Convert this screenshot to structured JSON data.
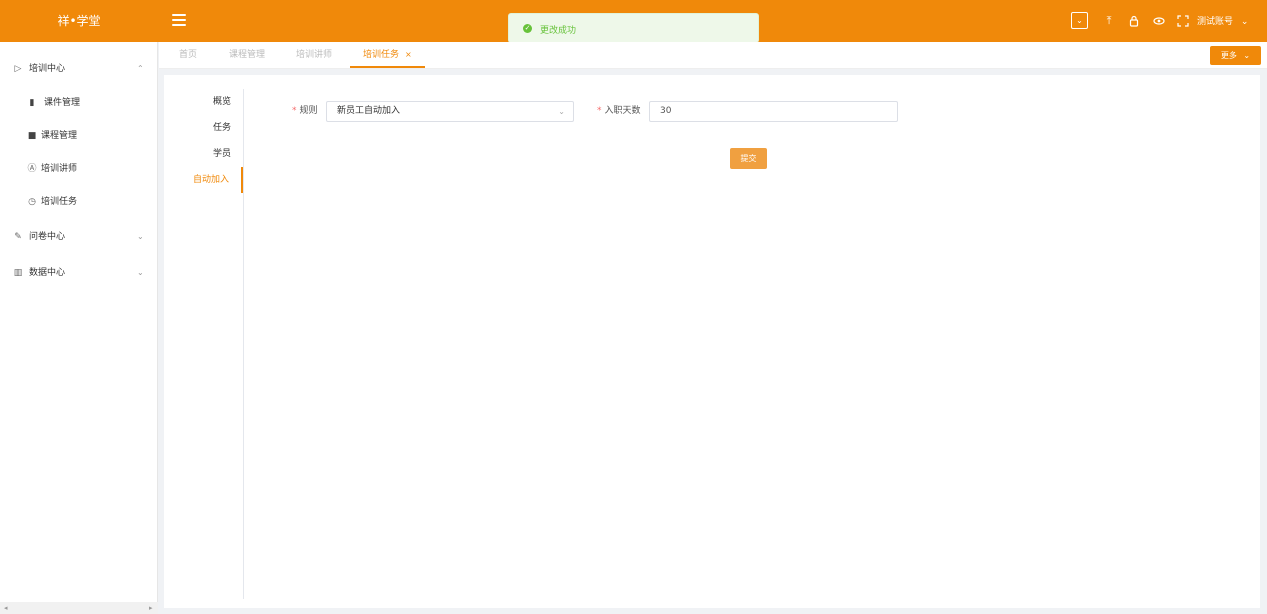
{
  "app": {
    "logo": "祥•学堂"
  },
  "toast": {
    "message": "更改成功",
    "icon": "check-circle-icon"
  },
  "header": {
    "icons": [
      "dropdown-box-icon",
      "upload-icon",
      "lock-icon",
      "eye-icon",
      "fullscreen-icon"
    ],
    "user_name": "测试账号"
  },
  "sidebar": {
    "groups": [
      {
        "label": "培训中心",
        "icon": "play-square-icon",
        "expanded": true
      },
      {
        "label": "问卷中心",
        "icon": "survey-icon",
        "expanded": false
      },
      {
        "label": "数据中心",
        "icon": "bar-chart-icon",
        "expanded": false
      }
    ],
    "items": [
      {
        "label": "课件管理",
        "icon": "book-icon"
      },
      {
        "label": "课程管理",
        "icon": "folder-icon"
      },
      {
        "label": "培训讲师",
        "icon": "user-circle-icon"
      },
      {
        "label": "培训任务",
        "icon": "clock-icon"
      }
    ]
  },
  "tabs": [
    {
      "label": "首页",
      "active": false
    },
    {
      "label": "课程管理",
      "active": false
    },
    {
      "label": "培训讲师",
      "active": false
    },
    {
      "label": "培训任务",
      "active": true
    }
  ],
  "more_button": "更多",
  "vertical_tabs": [
    {
      "label": "概览",
      "active": false
    },
    {
      "label": "任务",
      "active": false
    },
    {
      "label": "学员",
      "active": false
    },
    {
      "label": "自动加入",
      "active": true
    }
  ],
  "form": {
    "rule_label": "规则",
    "rule_value": "新员工自动加入",
    "days_label": "入职天数",
    "days_value": "30",
    "submit_label": "提交"
  },
  "colors": {
    "brand": "#f0890a",
    "success": "#67c23a",
    "required": "#f56c6c"
  }
}
